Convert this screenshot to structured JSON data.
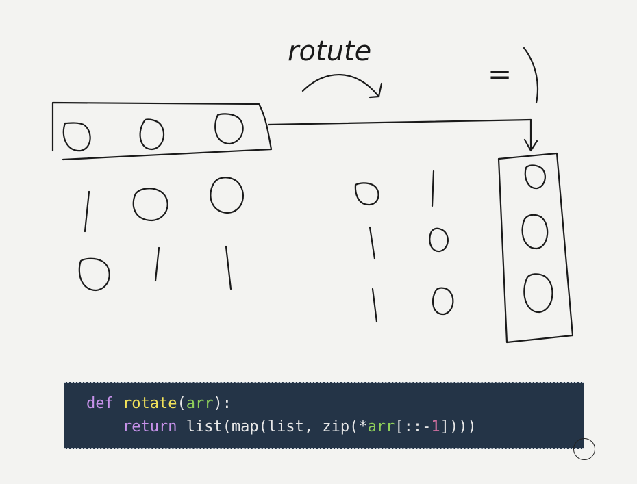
{
  "annotations": {
    "rotate_label": "rotute",
    "equals_label": "="
  },
  "left_matrix": {
    "rows": [
      [
        "0",
        "0",
        "0"
      ],
      [
        "1",
        "0",
        "0"
      ],
      [
        "0",
        "1",
        "1"
      ]
    ]
  },
  "rotated_matrix": {
    "rows": [
      [
        "0",
        "1",
        "0"
      ],
      [
        "1",
        "0",
        "0"
      ],
      [
        "1",
        "0",
        "0"
      ]
    ]
  },
  "code": {
    "line1": {
      "kw": "def",
      "fn": "rotate",
      "open": "(",
      "param": "arr",
      "close": "):"
    },
    "line2": {
      "indent": "    ",
      "kw": "return",
      "a": " list(map(list, zip(*",
      "param": "arr",
      "b": "[::-",
      "num": "1",
      "c": "])))"
    }
  },
  "colors": {
    "background": "#f3f3f1",
    "ink": "#1a1a1a",
    "code_bg": "#243447",
    "keyword": "#c792ea",
    "function": "#f2e25a",
    "param": "#8fcf5a",
    "number": "#d070a0"
  }
}
